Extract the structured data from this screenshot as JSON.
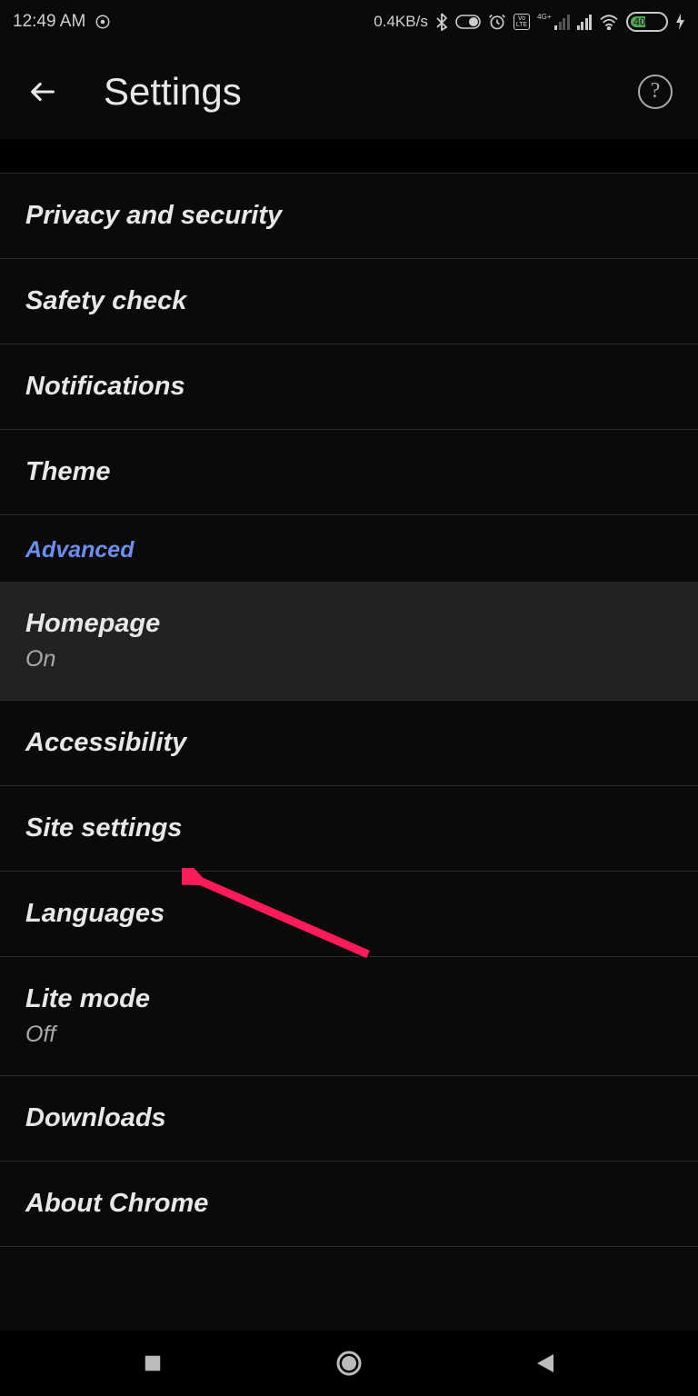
{
  "status": {
    "time": "12:49 AM",
    "data_rate": "0.4KB/s",
    "battery_pct": "40"
  },
  "header": {
    "title": "Settings"
  },
  "items": [
    {
      "title": "Privacy and security",
      "subtitle": ""
    },
    {
      "title": "Safety check",
      "subtitle": ""
    },
    {
      "title": "Notifications",
      "subtitle": ""
    },
    {
      "title": "Theme",
      "subtitle": ""
    }
  ],
  "section": "Advanced",
  "advanced_items": [
    {
      "title": "Homepage",
      "subtitle": "On",
      "highlight": true
    },
    {
      "title": "Accessibility",
      "subtitle": ""
    },
    {
      "title": "Site settings",
      "subtitle": ""
    },
    {
      "title": "Languages",
      "subtitle": ""
    },
    {
      "title": "Lite mode",
      "subtitle": "Off"
    },
    {
      "title": "Downloads",
      "subtitle": ""
    },
    {
      "title": "About Chrome",
      "subtitle": ""
    }
  ]
}
